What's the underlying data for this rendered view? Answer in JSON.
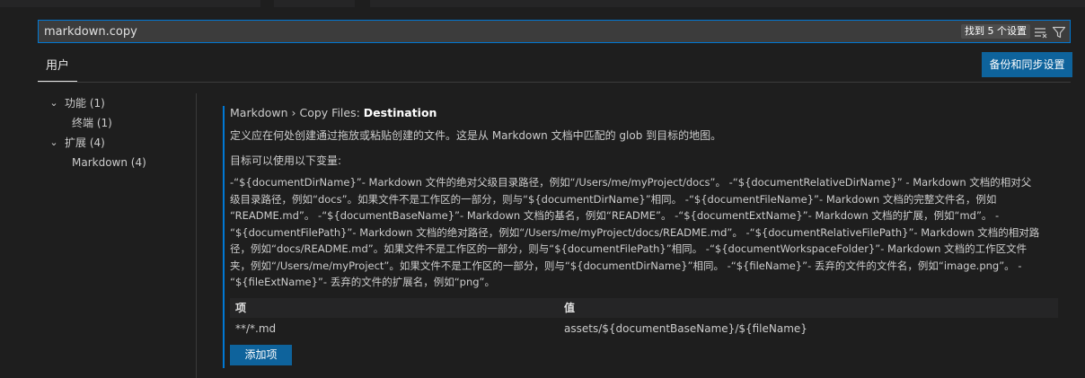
{
  "search": {
    "value": "markdown.copy",
    "result_count": "找到 5 个设置",
    "icons": [
      "clear-filter-icon",
      "filter-icon"
    ]
  },
  "tabs": [
    {
      "label": "用户"
    }
  ],
  "sync_button": {
    "label": "备份和同步设置"
  },
  "toc": {
    "items": [
      {
        "label": "功能 (1)",
        "expanded": true,
        "icon": "chevron-down-icon"
      },
      {
        "label": "终端 (1)"
      },
      {
        "label": "扩展 (4)",
        "expanded": true,
        "icon": "chevron-down-icon"
      },
      {
        "label": "Markdown (4)"
      }
    ]
  },
  "setting": {
    "category": "Markdown › Copy Files: ",
    "name": "Destination",
    "description": "定义应在何处创建通过拖放或粘贴创建的文件。这是从 Markdown 文档中匹配的 glob 到目标的地图。",
    "vars_intro": "目标可以使用以下变量:",
    "vars_lines": [
      "-“${documentDirName}”- Markdown 文件的绝对父级目录路径，例如“/Users/me/myProject/docs”。 -“${documentRelativeDirName}” - Markdown 文档的相对父",
      "级目录路径，例如“docs”。如果文件不是工作区的一部分，则与“${documentDirName}”相同。 -“${documentFileName}”- Markdown 文档的完整文件名，例如",
      "“README.md”。 -“${documentBaseName}”- Markdown 文档的基名，例如“README”。 -“${documentExtName}”- Markdown 文档的扩展，例如“md”。 -",
      "“${documentFilePath}”- Markdown 文档的绝对路径，例如“/Users/me/myProject/docs/README.md”。 -“${documentRelativeFilePath}”- Markdown 文档的相对路",
      "径，例如“docs/README.md”。如果文件不是工作区的一部分，则与“${documentFilePath}”相同。 -“${documentWorkspaceFolder}”- Markdown 文档的工作区文件",
      "夹，例如“/Users/me/myProject”。如果文件不是工作区的一部分，则与“${documentDirName}”相同。 -“${fileName}”- 丢弃的文件的文件名，例如“image.png”。 -",
      "“${fileExtName}”- 丢弃的文件的扩展名，例如“png”。"
    ],
    "table": {
      "headers": [
        "项",
        "值"
      ],
      "rows": [
        [
          "**/*.md",
          "assets/${documentBaseName}/${fileName}"
        ]
      ]
    },
    "add_button": "添加项"
  }
}
